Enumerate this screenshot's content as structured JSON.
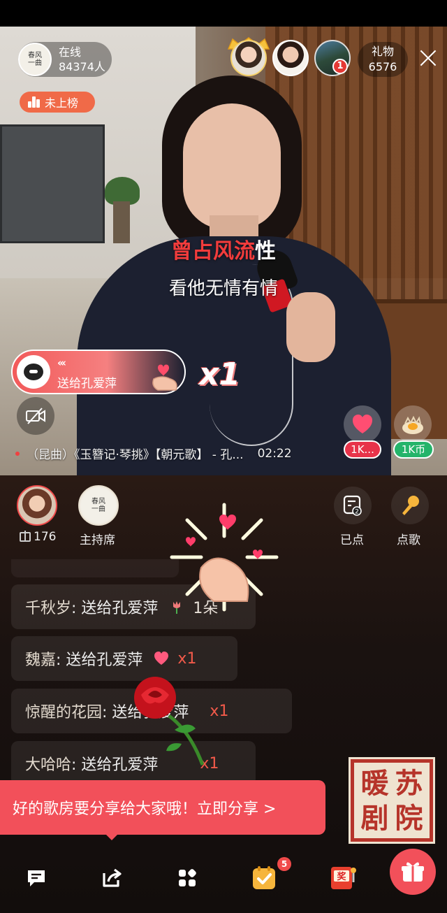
{
  "header": {
    "online_label": "在线",
    "online_count": "84374人",
    "rank_label": "未上榜",
    "gift_label": "礼物",
    "gift_count": "6576",
    "top3_badge": "1"
  },
  "video": {
    "lyric_highlight": "曾占风流",
    "lyric_rest": "性",
    "lyric_next": "看他无情有情",
    "song_info": "（昆曲）《玉簪记·琴挑》【朝元歌】 - 孔...",
    "song_time": "02:22",
    "gift_banner": {
      "arrows": "«‹",
      "text": "送给孔爱萍",
      "multiplier": "x1"
    },
    "react_heart_count": "1K...",
    "react_coin_label": "1K币"
  },
  "panel": {
    "host_gift_count": "176",
    "host_seat_label": "主持席",
    "ordered_label": "已点",
    "ordered_badge": "2",
    "request_label": "点歌"
  },
  "chat": [
    {
      "user": "千秋岁",
      "action": ": 送给孔爱萍",
      "qty": "1朵",
      "gift_icon": "tulip-icon"
    },
    {
      "user": "魏嘉",
      "action": ": 送给孔爱萍",
      "qty": "x1",
      "gift_icon": "heart-icon"
    },
    {
      "user": "惊醒的花园",
      "action": ": 送给孔爱萍",
      "qty": "x1",
      "gift_icon": "rose-icon"
    },
    {
      "user": "大哈哈",
      "action": ": 送给孔爱萍",
      "qty": "x1",
      "gift_icon": "rose-icon"
    }
  ],
  "toast": {
    "text": "好的歌房要分享给大家哦！立即分享 >"
  },
  "seal_chars": [
    "暖",
    "苏",
    "剧",
    "院"
  ],
  "bottom_bar": {
    "task_badge": "5",
    "lottery_char": "奖"
  },
  "colors": {
    "accent_red": "#f2505a",
    "rank_orange": "#f06a48",
    "coin_green": "#24b46a"
  }
}
